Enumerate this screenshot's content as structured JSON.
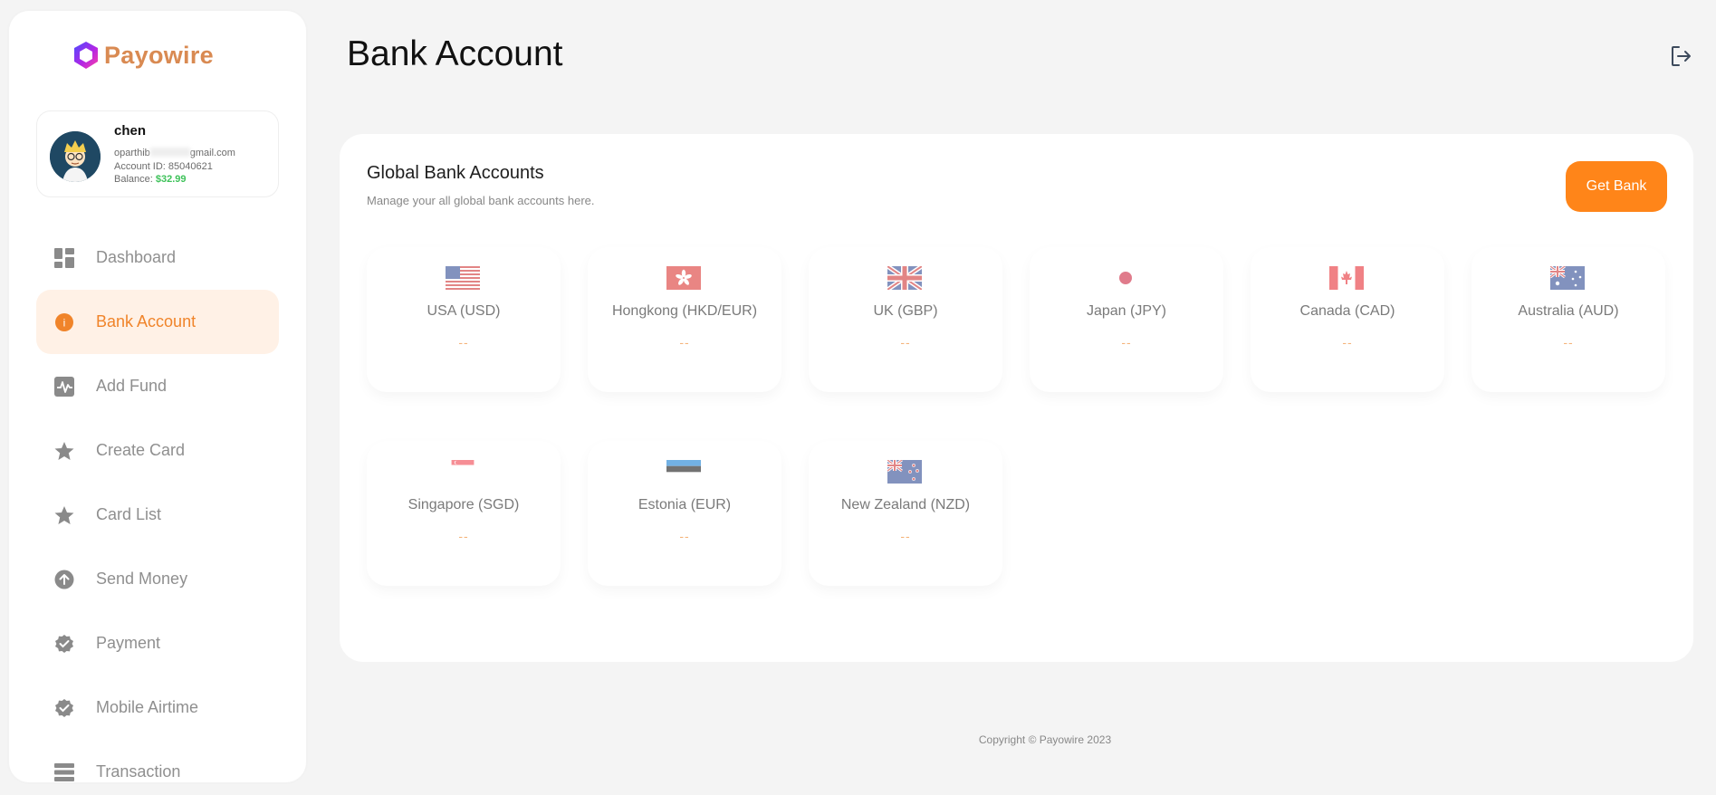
{
  "brand": {
    "name": "Payowire"
  },
  "profile": {
    "name": "chen",
    "email_prefix": "oparthib",
    "email_suffix": "gmail.com",
    "account_id": "Account ID: 85040621",
    "balance_label": "Balance:",
    "balance_value": "$32.99"
  },
  "nav": [
    {
      "label": "Dashboard",
      "icon": "dashboard-icon"
    },
    {
      "label": "Bank Account",
      "icon": "info-icon",
      "active": true
    },
    {
      "label": "Add Fund",
      "icon": "activity-icon"
    },
    {
      "label": "Create Card",
      "icon": "star-icon"
    },
    {
      "label": "Card List",
      "icon": "star-icon"
    },
    {
      "label": "Send Money",
      "icon": "arrow-up-circle-icon"
    },
    {
      "label": "Payment",
      "icon": "badge-check-icon"
    },
    {
      "label": "Mobile Airtime",
      "icon": "badge-check-icon"
    },
    {
      "label": "Transaction",
      "icon": "list-icon"
    }
  ],
  "header": {
    "title": "Bank Account",
    "logout_icon": "logout-icon"
  },
  "panel": {
    "title": "Global Bank Accounts",
    "subtitle": "Manage your all global bank accounts here.",
    "button_label": "Get Bank",
    "accounts": [
      {
        "label": "USA (USD)",
        "value": "--",
        "flag": "us-flag"
      },
      {
        "label": "Hongkong (HKD/EUR)",
        "value": "--",
        "flag": "hk-flag"
      },
      {
        "label": "UK (GBP)",
        "value": "--",
        "flag": "uk-flag"
      },
      {
        "label": "Japan (JPY)",
        "value": "--",
        "flag": "jp-flag"
      },
      {
        "label": "Canada (CAD)",
        "value": "--",
        "flag": "ca-flag"
      },
      {
        "label": "Australia (AUD)",
        "value": "--",
        "flag": "au-flag"
      },
      {
        "label": "Singapore (SGD)",
        "value": "--",
        "flag": "sg-flag"
      },
      {
        "label": "Estonia (EUR)",
        "value": "--",
        "flag": "ee-flag"
      },
      {
        "label": "New Zealand (NZD)",
        "value": "--",
        "flag": "nz-flag"
      }
    ]
  },
  "footer": {
    "text": "Copyright © Payowire 2023"
  },
  "colors": {
    "accent": "#ff8519",
    "active_bg": "#fff1e6",
    "balance": "#3ec25a"
  }
}
